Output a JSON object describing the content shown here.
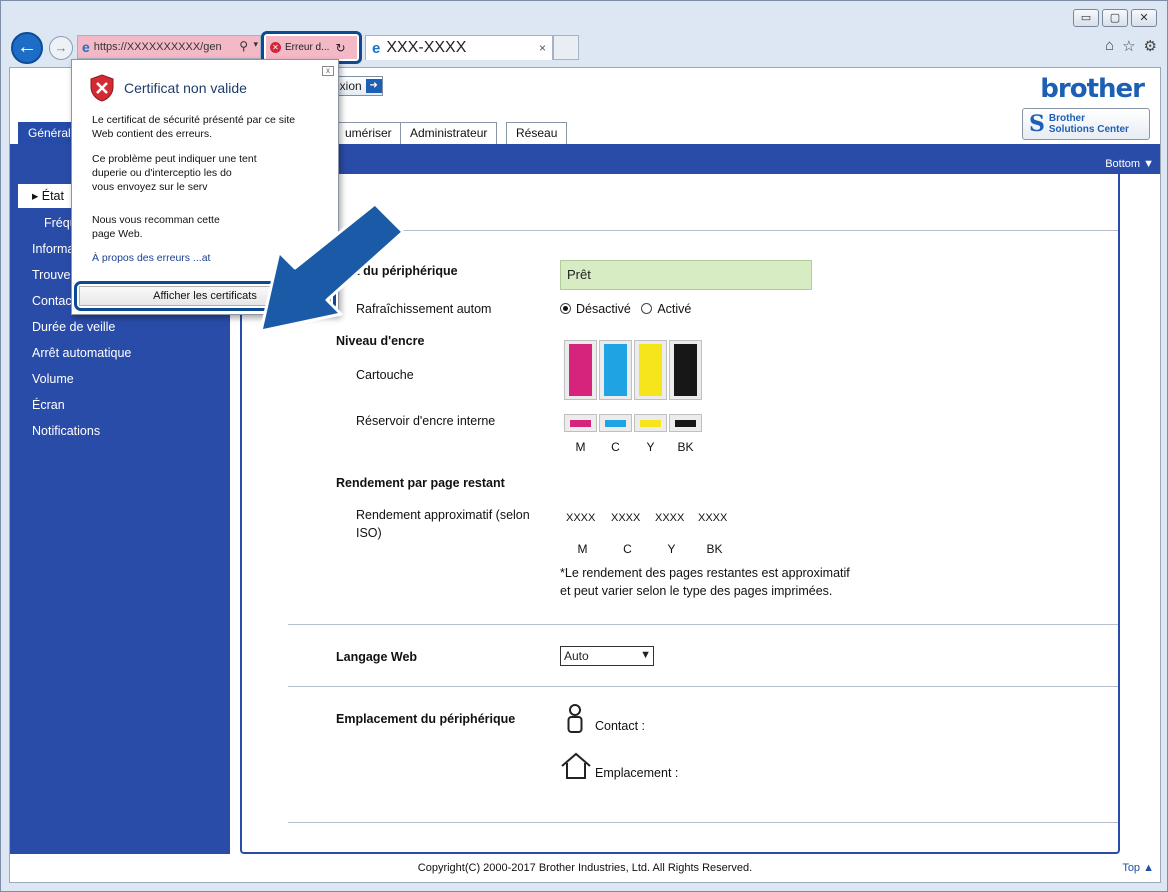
{
  "browser": {
    "address_url": "https://XXXXXXXXXX/gen",
    "cert_error_label": "Erreur d...",
    "tab_title": "XXX-XXXX",
    "min_glyph": "▭",
    "max_glyph": "▢",
    "close_glyph": "✕",
    "back_glyph": "←",
    "forward_glyph": "→",
    "tab_close_glyph": "×"
  },
  "header": {
    "brand": "brother",
    "login_label": "exion",
    "bsc_line1": "Brother",
    "bsc_line2": "Solutions Center"
  },
  "menu_tabs": [
    {
      "label": "Général"
    },
    {
      "label": "umériser"
    },
    {
      "label": "Administrateur"
    },
    {
      "label": "Réseau"
    }
  ],
  "bottom_link": "Bottom ▼",
  "sidebar": {
    "items": [
      {
        "label": "État"
      },
      {
        "label": "Fréqu"
      },
      {
        "label": "Informa"
      },
      {
        "label": "Trouve"
      },
      {
        "label": "Contac"
      },
      {
        "label": "Durée de veille"
      },
      {
        "label": "Arrêt automatique"
      },
      {
        "label": "Volume"
      },
      {
        "label": "Écran"
      },
      {
        "label": "Notifications"
      }
    ]
  },
  "content": {
    "device_status_label": "État du périphérique",
    "device_status_value": "Prêt",
    "auto_refresh_label": "Rafraîchissement autom",
    "refresh_off": "Désactivé",
    "refresh_on": "Activé",
    "ink_level_label": "Niveau d'encre",
    "cartridge_label": "Cartouche",
    "tank_label": "Réservoir d'encre interne",
    "colors": [
      "M",
      "C",
      "Y",
      "BK"
    ],
    "ink_colors": [
      "#d6237b",
      "#1fa3e2",
      "#f7e51b",
      "#171717"
    ],
    "yield_label": "Rendement par page restant",
    "approx_yield_label_1": "Rendement approximatif (selon",
    "approx_yield_label_2": "ISO)",
    "yield_values": [
      "XXXX",
      "XXXX",
      "XXXX",
      "XXXX"
    ],
    "yield_note_1": "*Le rendement des pages restantes est approximatif",
    "yield_note_2": "et peut varier selon le type des pages imprimées.",
    "web_language_label": "Langage Web",
    "web_language_value": "Auto",
    "location_label": "Emplacement du périphérique",
    "contact_label": "Contact :",
    "location_field_label": "Emplacement :"
  },
  "footer": {
    "copyright": "Copyright(C) 2000-2017 Brother Industries, Ltd. All Rights Reserved.",
    "top_link": "Top ▲"
  },
  "popup": {
    "title": "Certificat non valide",
    "para1_line1": "Le certificat de sécurité présenté par ce site",
    "para1_line2": "Web contient des erreurs.",
    "para2_line1": "Ce problème peut indiquer une tent",
    "para2_line2": "duperie ou d'interceptio   les do",
    "para2_line3": "vous envoyez sur le serv",
    "para3_line1": "Nous vous recomman              cette",
    "para3_line2": "page Web.",
    "link": "À propos des erreurs              ...at",
    "button": "Afficher les certificats",
    "close_glyph": "x"
  }
}
